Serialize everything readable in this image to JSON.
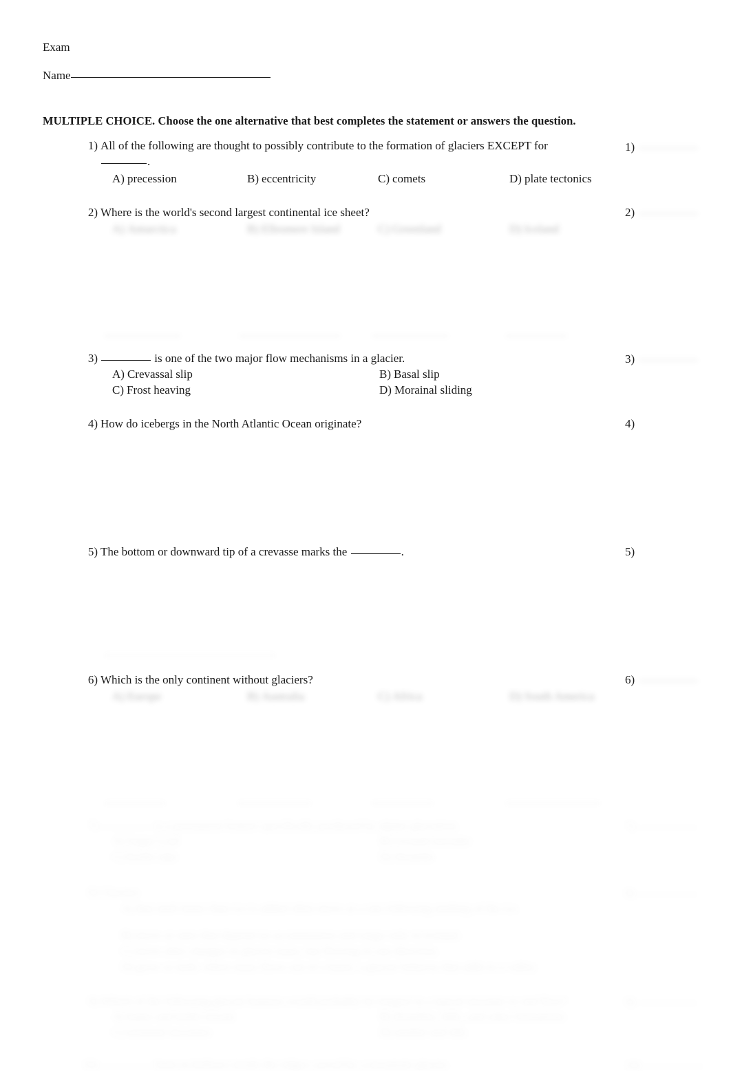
{
  "document": {
    "header_label": "Exam",
    "name_label": "Name"
  },
  "instructions": "MULTIPLE CHOICE.  Choose the one alternative that best completes the statement or answers the question.",
  "questions": [
    {
      "number": "1)",
      "stem_before": "All of the following are thought to possibly contribute to the formation of glaciers EXCEPT for",
      "stem_after": ".",
      "answer_mark": "1)",
      "layout": "four-column",
      "options": [
        {
          "letter": "A)",
          "text": "precession"
        },
        {
          "letter": "B)",
          "text": "eccentricity"
        },
        {
          "letter": "C)",
          "text": "comets"
        },
        {
          "letter": "D)",
          "text": "plate tectonics"
        }
      ]
    },
    {
      "number": "2)",
      "stem": "Where is the world's second largest continental ice sheet?",
      "answer_mark": "2)",
      "layout": "four-column",
      "redacted": true,
      "options": [
        {
          "letter": "A)",
          "text": "Antarctica"
        },
        {
          "letter": "B)",
          "text": "Ellesmere Island"
        },
        {
          "letter": "C)",
          "text": "Greenland"
        },
        {
          "letter": "D)",
          "text": "Iceland"
        }
      ]
    },
    {
      "number": "3)",
      "stem_before": "",
      "stem_after": "is one of the two major flow mechanisms in a glacier.",
      "answer_mark": "3)",
      "layout": "two-column",
      "options": [
        {
          "letter": "A)",
          "text": "Crevassal slip"
        },
        {
          "letter": "B)",
          "text": "Basal slip"
        },
        {
          "letter": "C)",
          "text": "Frost heaving"
        },
        {
          "letter": "D)",
          "text": "Morainal sliding"
        }
      ]
    },
    {
      "number": "4)",
      "stem": "How do icebergs in the North Atlantic Ocean originate?",
      "answer_mark": "4)",
      "layout": "none",
      "options": []
    },
    {
      "number": "5)",
      "stem_before": "The bottom or downward tip of a crevasse marks the",
      "stem_after": ".",
      "answer_mark": "5)",
      "layout": "none",
      "options": []
    },
    {
      "number": "6)",
      "stem": "Which is the only continent without glaciers?",
      "answer_mark": "6)",
      "layout": "four-column",
      "redacted": true,
      "options": [
        {
          "letter": "A)",
          "text": "Europe"
        },
        {
          "letter": "B)",
          "text": "Australia"
        },
        {
          "letter": "C)",
          "text": "Africa"
        },
        {
          "letter": "D)",
          "text": "South America"
        }
      ]
    },
    {
      "number": "7)",
      "stem": "is a permanent feature specifically produced by alpine glaciation.",
      "answer_mark": "7)",
      "layout": "two-column",
      "redacted": true,
      "options": [
        {
          "letter": "A)",
          "text": "Sugar Loaf"
        },
        {
          "letter": "B)",
          "text": "Ground moraine"
        },
        {
          "letter": "C)",
          "text": "Kettle lake"
        },
        {
          "letter": "D)",
          "text": "Drumlin"
        }
      ]
    },
    {
      "number": "8)",
      "stem": "Glaciers",
      "answer_mark": "8)",
      "layout": "stacked",
      "redacted": true,
      "options": [
        {
          "letter": "A)",
          "text": "that melt faster than ice is added often move at a rate following melting of the ice."
        },
        {
          "letter": "B)",
          "text": "move at rates that depend on accumulation and outgo only in Iceland."
        },
        {
          "letter": "C)",
          "text": "move after changes in glacier mass, but flowing in one direction."
        },
        {
          "letter": "D)",
          "text": "grow or melt, where mass flows out of a basin, a glacier behaves that adds to a valley."
        }
      ]
    },
    {
      "number": "9)",
      "stem": "Which of the following glacial features would probably be longest in a lateral moraine or end flow?",
      "answer_mark": "9)",
      "layout": "two-column",
      "redacted": true,
      "options": [
        {
          "letter": "A)",
          "text": "kame and kettle terrain"
        },
        {
          "letter": "B)",
          "text": "drumlins, hills, and esker formations"
        },
        {
          "letter": "C)",
          "text": "terminal moraines"
        },
        {
          "letter": "D)",
          "text": "medial and tills"
        }
      ]
    },
    {
      "number": "10)",
      "stem": "form in hollows inside the ridges carved by a mountain glacier.",
      "answer_mark": "10)",
      "layout": "none",
      "redacted": true,
      "options": []
    }
  ]
}
